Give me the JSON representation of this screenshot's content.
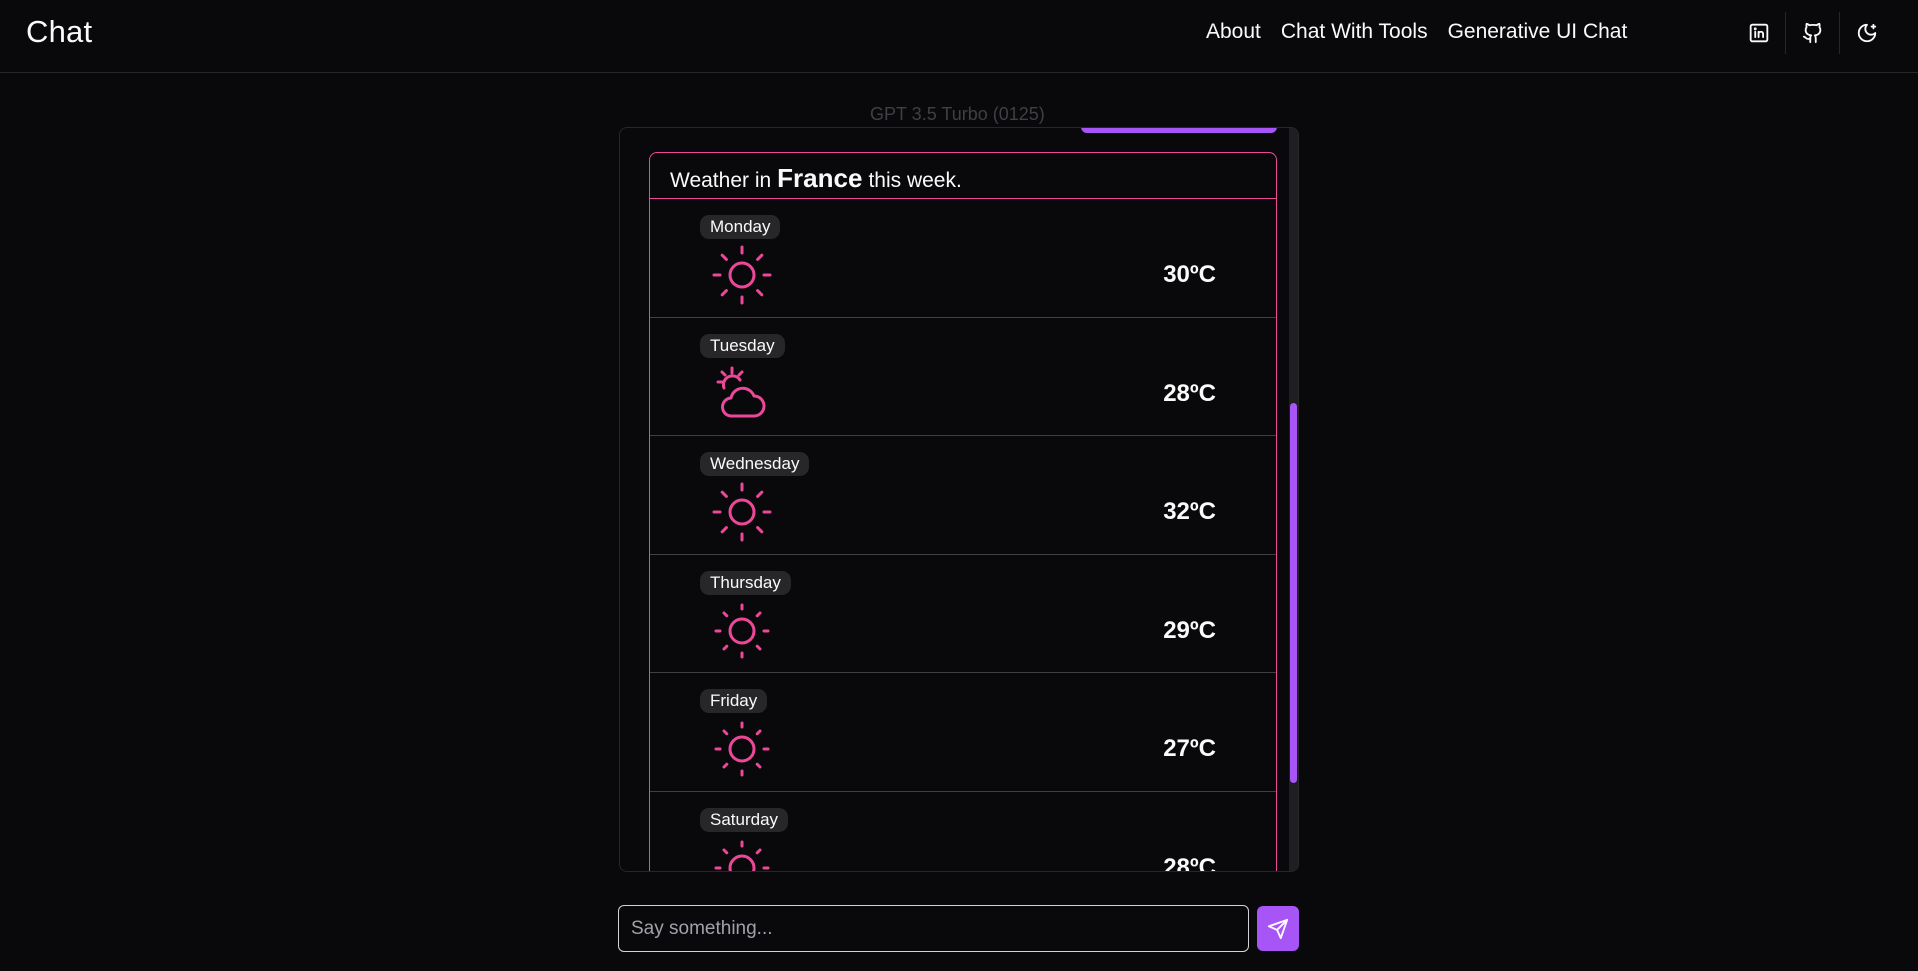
{
  "header": {
    "brand": "Chat",
    "nav": [
      {
        "label": "About"
      },
      {
        "label": "Chat With Tools"
      },
      {
        "label": "Generative UI Chat"
      }
    ],
    "icons": [
      "linkedin-icon",
      "github-icon",
      "theme-toggle-icon"
    ]
  },
  "model_label": "GPT 3.5 Turbo (0125)",
  "weather": {
    "prefix": "Weather in",
    "country": "France",
    "suffix": "this week.",
    "days": [
      {
        "day": "Monday",
        "icon": "sun-icon",
        "temp": "30ºC"
      },
      {
        "day": "Tuesday",
        "icon": "partly-cloudy-icon",
        "temp": "28ºC"
      },
      {
        "day": "Wednesday",
        "icon": "sun-icon",
        "temp": "32ºC"
      },
      {
        "day": "Thursday",
        "icon": "sun-icon",
        "temp": "29ºC"
      },
      {
        "day": "Friday",
        "icon": "sun-icon",
        "temp": "27ºC"
      },
      {
        "day": "Saturday",
        "icon": "sun-icon",
        "temp": "28ºC"
      }
    ]
  },
  "composer": {
    "placeholder": "Say something..."
  },
  "colors": {
    "accent": "#a855f7",
    "weather": "#ec4899",
    "background": "#09090b"
  }
}
